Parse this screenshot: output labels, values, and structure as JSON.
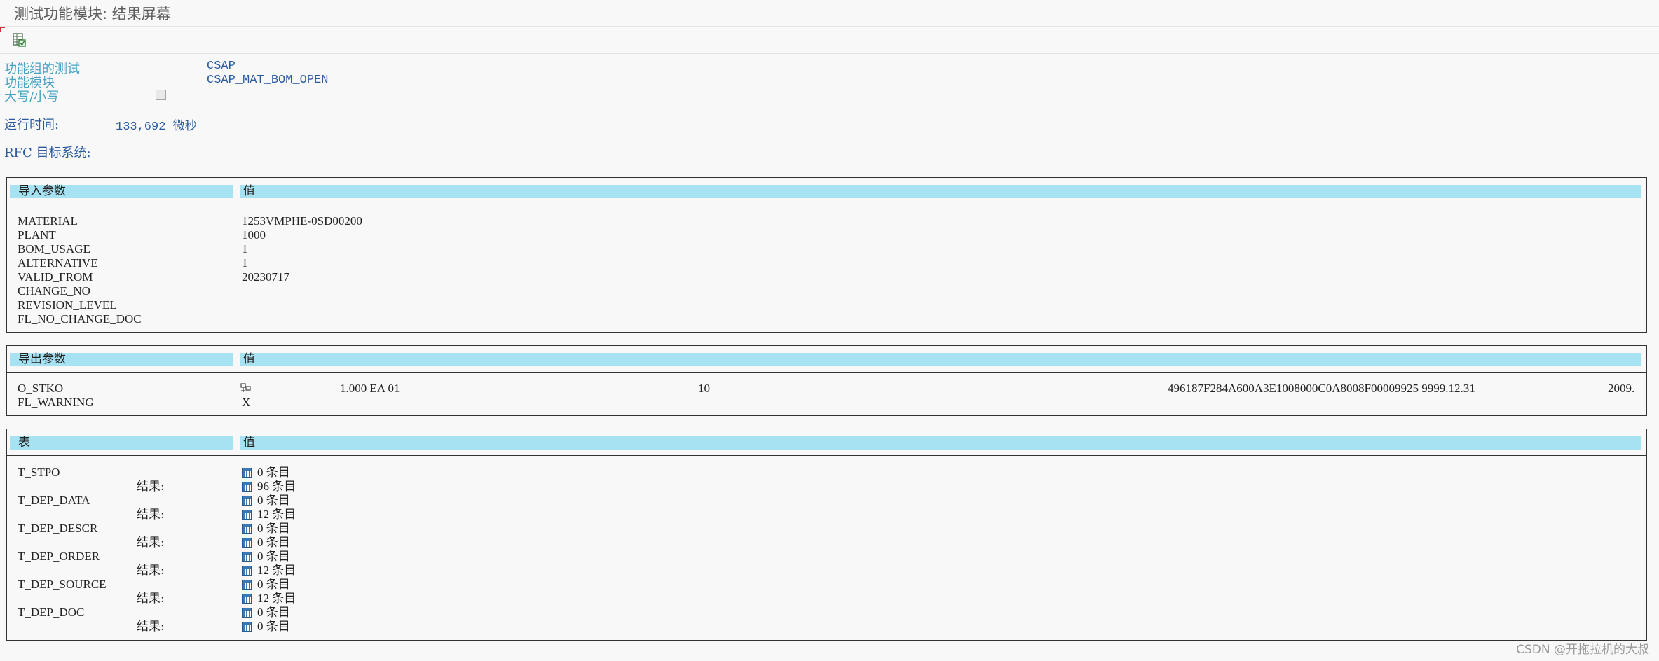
{
  "window": {
    "title": "测试功能模块: 结果屏幕"
  },
  "toolbar": {
    "icon": "spreadsheet-view-icon"
  },
  "info": {
    "function_group_label": "功能组的测试",
    "function_group_value": "CSAP",
    "function_module_label": "功能模块",
    "function_module_value": "CSAP_MAT_BOM_OPEN",
    "case_label": "大写/小写",
    "case_checked": false,
    "runtime_label": "运行时间:",
    "runtime_value": "133,692 微秒",
    "rfc_label": "RFC 目标系统:"
  },
  "import_params": {
    "header_param": "导入参数",
    "header_value": "值",
    "rows": [
      {
        "name": "MATERIAL",
        "value": "1253VMPHE-0SD00200"
      },
      {
        "name": "PLANT",
        "value": "1000"
      },
      {
        "name": "BOM_USAGE",
        "value": "1"
      },
      {
        "name": "ALTERNATIVE",
        "value": "1"
      },
      {
        "name": "VALID_FROM",
        "value": "20230717"
      },
      {
        "name": "CHANGE_NO",
        "value": ""
      },
      {
        "name": "REVISION_LEVEL",
        "value": ""
      },
      {
        "name": "FL_NO_CHANGE_DOC",
        "value": ""
      }
    ]
  },
  "export_params": {
    "header_param": "导出参数",
    "header_value": "值",
    "o_stko": {
      "name": "O_STKO",
      "seg1": "1.000 EA 01",
      "seg2": "10",
      "seg3": "496187F284A600A3E1008000C0A8008F00009925 9999.12.31",
      "seg4": "2009."
    },
    "fl_warning": {
      "name": "FL_WARNING",
      "value": "X"
    }
  },
  "tables": {
    "header_param": "表",
    "header_value": "值",
    "result_label": "结果:",
    "rows": [
      {
        "name": "T_STPO",
        "before": "0 条目",
        "after": "96 条目"
      },
      {
        "name": "T_DEP_DATA",
        "before": "0 条目",
        "after": "12 条目"
      },
      {
        "name": "T_DEP_DESCR",
        "before": "0 条目",
        "after": "0 条目"
      },
      {
        "name": "T_DEP_ORDER",
        "before": "0 条目",
        "after": "12 条目"
      },
      {
        "name": "T_DEP_SOURCE",
        "before": "0 条目",
        "after": "12 条目"
      },
      {
        "name": "T_DEP_DOC",
        "before": "0 条目",
        "after": "0 条目"
      }
    ]
  },
  "footer": {
    "watermark": "CSDN @开拖拉机的大叔"
  }
}
